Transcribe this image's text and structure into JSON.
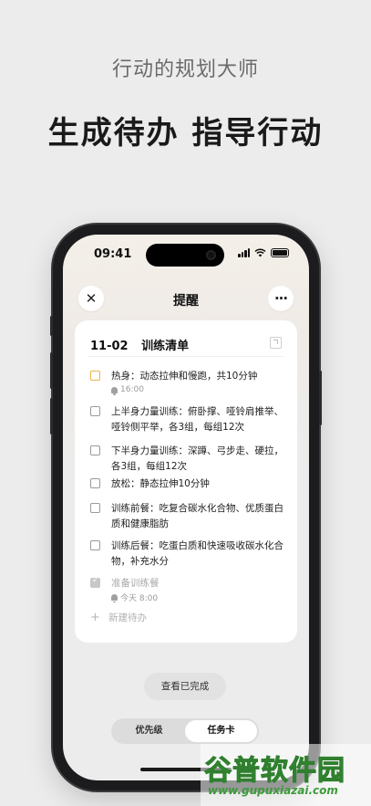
{
  "promo": {
    "subtitle": "行动的规划大师",
    "headline": "生成待办 指导行动"
  },
  "status_bar": {
    "time": "09:41"
  },
  "topbar": {
    "close_icon": "close-icon",
    "title": "提醒",
    "more_icon": "more-icon",
    "more_label": "···"
  },
  "card": {
    "date": "11-02",
    "title": "训练清单",
    "expand_icon": "expand-icon",
    "tasks": [
      {
        "text": "热身：动态拉伸和慢跑，共10分钟",
        "meta": "16:00",
        "state": "active"
      },
      {
        "text": "上半身力量训练：俯卧撑、哑铃肩推举、哑铃侧平举，各3组，每组12次",
        "state": "open"
      },
      {
        "text": "下半身力量训练：深蹲、弓步走、硬拉，各3组，每组12次",
        "state": "open"
      },
      {
        "text": "放松：静态拉伸10分钟",
        "state": "open"
      },
      {
        "text": "训练前餐：吃复合碳水化合物、优质蛋白质和健康脂肪",
        "state": "open"
      },
      {
        "text": "训练后餐：吃蛋白质和快速吸收碳水化合物，补充水分",
        "state": "open"
      },
      {
        "text": "准备训练餐",
        "meta": "今天 8:00",
        "state": "done"
      }
    ],
    "new_task_label": "新建待办"
  },
  "view_done_label": "查看已完成",
  "segments": {
    "left": "优先级",
    "right": "任务卡",
    "selected": "任务卡"
  },
  "watermark": {
    "text": "谷普软件园",
    "url": "www.gupuxiazai.com"
  },
  "colors": {
    "active_checkbox": "#e9b44c",
    "watermark_green": "#3c9a3a"
  }
}
